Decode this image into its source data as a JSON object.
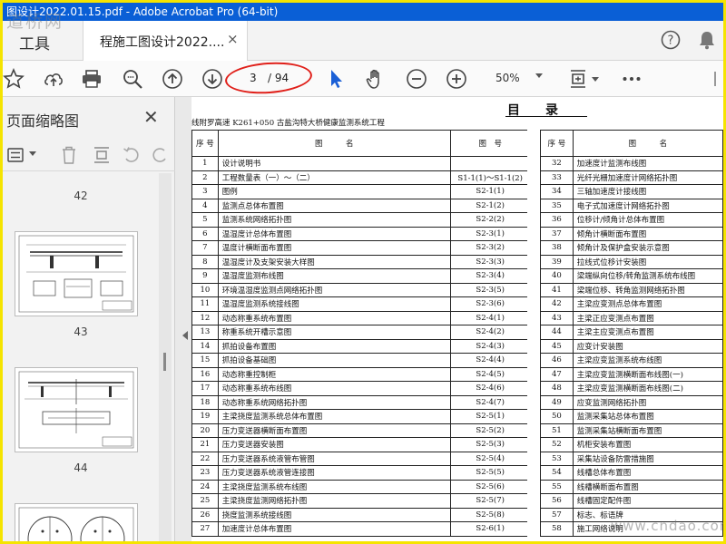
{
  "window": {
    "title": "图设计2022.01.15.pdf - Adobe Acrobat Pro (64-bit)",
    "watermark_top": "道桥网"
  },
  "tabs": {
    "tools_label": "工具",
    "document_label": "程施工图设计2022....",
    "close_glyph": "×"
  },
  "toolbar": {
    "page_current": "3",
    "page_total": "/ 94",
    "zoom": "50%",
    "accent_color": "#1a5fd6",
    "highlight_color": "#e0201a"
  },
  "sidebar": {
    "title": "页面缩略图",
    "close_glyph": "✕",
    "thumbnail_numbers": [
      "42",
      "43",
      "44"
    ]
  },
  "document": {
    "heading": "目　　录",
    "subtitle": "线附罗高速 K261+050 古盐沟特大桥健康监测系统工程",
    "left_headers": [
      "序 号",
      "图　　　名",
      "图　号"
    ],
    "right_headers": [
      "序 号",
      "图　　　名"
    ],
    "left_rows": [
      [
        "1",
        "设计说明书",
        ""
      ],
      [
        "2",
        "工程数量表（一）～（二）",
        "S1-1(1)～S1-1(2)"
      ],
      [
        "3",
        "图例",
        "S2-1(1)"
      ],
      [
        "4",
        "监测点总体布置图",
        "S2-1(2)"
      ],
      [
        "5",
        "监测系统网络拓扑图",
        "S2-2(2)"
      ],
      [
        "6",
        "温湿度计总体布置图",
        "S2-3(1)"
      ],
      [
        "7",
        "温度计横断面布置图",
        "S2-3(2)"
      ],
      [
        "8",
        "温湿度计及支架安装大样图",
        "S2-3(3)"
      ],
      [
        "9",
        "温湿度监测布线图",
        "S2-3(4)"
      ],
      [
        "10",
        "环境温湿度监测点网络拓扑图",
        "S2-3(5)"
      ],
      [
        "11",
        "温湿度监测系统接线图",
        "S2-3(6)"
      ],
      [
        "12",
        "动态称重系统布置图",
        "S2-4(1)"
      ],
      [
        "13",
        "称重系统开槽示意图",
        "S2-4(2)"
      ],
      [
        "14",
        "抓拍设备布置图",
        "S2-4(3)"
      ],
      [
        "15",
        "抓拍设备基础图",
        "S2-4(4)"
      ],
      [
        "16",
        "动态称重控制柜",
        "S2-4(5)"
      ],
      [
        "17",
        "动态称重系统布线图",
        "S2-4(6)"
      ],
      [
        "18",
        "动态称重系统网络拓扑图",
        "S2-4(7)"
      ],
      [
        "19",
        "主梁挠度监测系统总体布置图",
        "S2-5(1)"
      ],
      [
        "20",
        "压力变送器横断面布置图",
        "S2-5(2)"
      ],
      [
        "21",
        "压力变送器安装图",
        "S2-5(3)"
      ],
      [
        "22",
        "压力变送器系统液管布管图",
        "S2-5(4)"
      ],
      [
        "23",
        "压力变送器系统液管连接图",
        "S2-5(5)"
      ],
      [
        "24",
        "主梁挠度监测系统布线图",
        "S2-5(6)"
      ],
      [
        "25",
        "主梁挠度监测网络拓扑图",
        "S2-5(7)"
      ],
      [
        "26",
        "挠度监测系统接线图",
        "S2-5(8)"
      ],
      [
        "27",
        "加速度计总体布置图",
        "S2-6(1)"
      ]
    ],
    "right_rows": [
      [
        "32",
        "加速度计监测布线图"
      ],
      [
        "33",
        "光纤光栅加速度计网络拓扑图"
      ],
      [
        "34",
        "三轴加速度计接线图"
      ],
      [
        "35",
        "电子式加速度计网络拓扑图"
      ],
      [
        "36",
        "位移计/倾角计总体布置图"
      ],
      [
        "37",
        "倾角计横断面布置图"
      ],
      [
        "38",
        "倾角计及保护盒安装示意图"
      ],
      [
        "39",
        "拉线式位移计安装图"
      ],
      [
        "40",
        "梁端纵向位移/转角监测系统布线图"
      ],
      [
        "41",
        "梁端位移、转角监测网络拓扑图"
      ],
      [
        "42",
        "主梁应变测点总体布置图"
      ],
      [
        "43",
        "主梁正应变测点布置图"
      ],
      [
        "44",
        "主梁主应变测点布置图"
      ],
      [
        "45",
        "应变计安装图"
      ],
      [
        "46",
        "主梁应变监测系统布线图"
      ],
      [
        "47",
        "主梁应变监测横断面布线图(一)"
      ],
      [
        "48",
        "主梁应变监测横断面布线图(二)"
      ],
      [
        "49",
        "应变监测网络拓扑图"
      ],
      [
        "50",
        "监测采集站总体布置图"
      ],
      [
        "51",
        "监测采集站横断面布置图"
      ],
      [
        "52",
        "机柜安装布置图"
      ],
      [
        "53",
        "采集站设备防雷措施图"
      ],
      [
        "54",
        "线槽总体布置图"
      ],
      [
        "55",
        "线槽横断面布置图"
      ],
      [
        "56",
        "线槽固定配件图"
      ],
      [
        "57",
        "标志、标语牌"
      ],
      [
        "58",
        "施工网络说明"
      ]
    ],
    "watermark_bottom": "www.cndao.com"
  }
}
